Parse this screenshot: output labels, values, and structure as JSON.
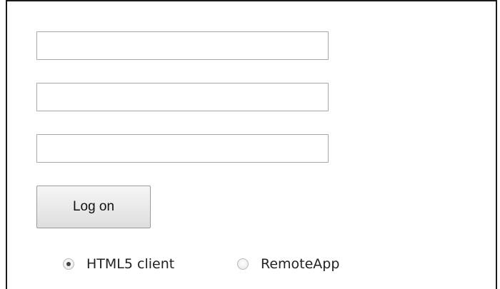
{
  "form": {
    "fields": [
      {
        "value": "",
        "placeholder": ""
      },
      {
        "value": "",
        "placeholder": ""
      },
      {
        "value": "",
        "placeholder": ""
      }
    ],
    "logon_label": "Log on"
  },
  "client_options": {
    "selected": "html5",
    "html5_label": "HTML5 client",
    "remoteapp_label": "RemoteApp"
  }
}
